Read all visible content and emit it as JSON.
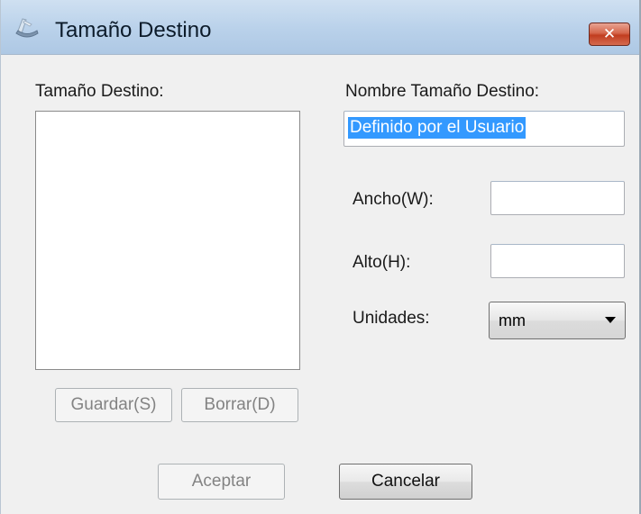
{
  "window": {
    "title": "Tamaño Destino",
    "close_label": "✕"
  },
  "left_panel": {
    "label": "Tamaño Destino:",
    "items": []
  },
  "right_panel": {
    "name_label": "Nombre Tamaño Destino:",
    "name_value": "Definido por el Usuario",
    "width_label": "Ancho(W):",
    "width_value": "",
    "height_label": "Alto(H):",
    "height_value": "",
    "units_label": "Unidades:",
    "units_value": "mm"
  },
  "buttons": {
    "save": "Guardar(S)",
    "delete": "Borrar(D)",
    "ok": "Aceptar",
    "cancel": "Cancelar"
  },
  "colors": {
    "selection": "#3399ff",
    "close_button": "#c13d1f",
    "titlebar": "#b9d1ea"
  },
  "icons": {
    "title": "scanner-icon",
    "dropdown": "chevron-down-icon"
  }
}
